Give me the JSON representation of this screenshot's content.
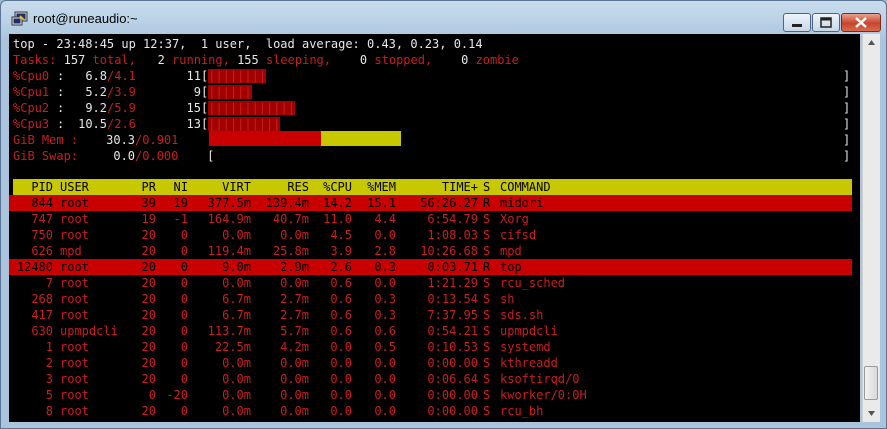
{
  "window": {
    "title": "root@runeaudio:~"
  },
  "summary": {
    "line1": "top - 23:48:45 up 12:37,  1 user,  load average: 0.43, 0.23, 0.14",
    "tasks": {
      "label": "Tasks:",
      "total": "157",
      "total_lbl": "total,",
      "running": "2",
      "running_lbl": "running,",
      "sleeping": "155",
      "sleeping_lbl": "sleeping,",
      "stopped": "0",
      "stopped_lbl": "stopped,",
      "zombie": "0",
      "zombie_lbl": "zombie"
    },
    "cpus": [
      {
        "name": "%Cpu0",
        "sep": ":",
        "value": "6.8",
        "sub": "/4.1",
        "num": "11",
        "bars": "||||||||"
      },
      {
        "name": "%Cpu1",
        "sep": ":",
        "value": "5.2",
        "sub": "/3.9",
        "num": "9",
        "bars": "||||||"
      },
      {
        "name": "%Cpu2",
        "sep": ":",
        "value": "9.2",
        "sub": "/5.9",
        "num": "15",
        "bars": "||||||||||||"
      },
      {
        "name": "%Cpu3",
        "sep": ":",
        "value": "10.5",
        "sub": "/2.6",
        "num": "13",
        "bars": "||||||||||"
      }
    ],
    "mem": {
      "name": "GiB Mem :",
      "value": "30.3",
      "sub": "/0.901",
      "used_fraction": 0.303,
      "cache_fraction": 0.24
    },
    "swap": {
      "name": "GiB Swap:",
      "value": "0.0",
      "sub": "/0.000"
    },
    "open_bracket": "[",
    "close_bracket": "]"
  },
  "columns": [
    "PID",
    "USER",
    "PR",
    "NI",
    "VIRT",
    "RES",
    "%CPU",
    "%MEM",
    "TIME+",
    "S",
    "COMMAND"
  ],
  "processes": [
    {
      "pid": "844",
      "user": "root",
      "pr": "39",
      "ni": "19",
      "virt": "377.5m",
      "res": "139.4m",
      "cpu": "14.2",
      "mem": "15.1",
      "time": "56:26.27",
      "s": "R",
      "cmd": "midori",
      "hl": true
    },
    {
      "pid": "747",
      "user": "root",
      "pr": "19",
      "ni": "-1",
      "virt": "164.9m",
      "res": "40.7m",
      "cpu": "11.0",
      "mem": "4.4",
      "time": "6:54.79",
      "s": "S",
      "cmd": "Xorg",
      "hl": false
    },
    {
      "pid": "750",
      "user": "root",
      "pr": "20",
      "ni": "0",
      "virt": "0.0m",
      "res": "0.0m",
      "cpu": "4.5",
      "mem": "0.0",
      "time": "1:08.03",
      "s": "S",
      "cmd": "cifsd",
      "hl": false
    },
    {
      "pid": "626",
      "user": "mpd",
      "pr": "20",
      "ni": "0",
      "virt": "119.4m",
      "res": "25.8m",
      "cpu": "3.9",
      "mem": "2.8",
      "time": "10:26.68",
      "s": "S",
      "cmd": "mpd",
      "hl": false
    },
    {
      "pid": "12480",
      "user": "root",
      "pr": "20",
      "ni": "0",
      "virt": "9.0m",
      "res": "2.9m",
      "cpu": "2.6",
      "mem": "0.3",
      "time": "0:03.71",
      "s": "R",
      "cmd": "top",
      "hl": true
    },
    {
      "pid": "7",
      "user": "root",
      "pr": "20",
      "ni": "0",
      "virt": "0.0m",
      "res": "0.0m",
      "cpu": "0.6",
      "mem": "0.0",
      "time": "1:21.29",
      "s": "S",
      "cmd": "rcu_sched",
      "hl": false
    },
    {
      "pid": "268",
      "user": "root",
      "pr": "20",
      "ni": "0",
      "virt": "6.7m",
      "res": "2.7m",
      "cpu": "0.6",
      "mem": "0.3",
      "time": "0:13.54",
      "s": "S",
      "cmd": "sh",
      "hl": false
    },
    {
      "pid": "417",
      "user": "root",
      "pr": "20",
      "ni": "0",
      "virt": "6.7m",
      "res": "2.7m",
      "cpu": "0.6",
      "mem": "0.3",
      "time": "7:37.95",
      "s": "S",
      "cmd": "sds.sh",
      "hl": false
    },
    {
      "pid": "630",
      "user": "upmpdcli",
      "pr": "20",
      "ni": "0",
      "virt": "113.7m",
      "res": "5.7m",
      "cpu": "0.6",
      "mem": "0.6",
      "time": "0:54.21",
      "s": "S",
      "cmd": "upmpdcli",
      "hl": false
    },
    {
      "pid": "1",
      "user": "root",
      "pr": "20",
      "ni": "0",
      "virt": "22.5m",
      "res": "4.2m",
      "cpu": "0.0",
      "mem": "0.5",
      "time": "0:10.53",
      "s": "S",
      "cmd": "systemd",
      "hl": false
    },
    {
      "pid": "2",
      "user": "root",
      "pr": "20",
      "ni": "0",
      "virt": "0.0m",
      "res": "0.0m",
      "cpu": "0.0",
      "mem": "0.0",
      "time": "0:00.00",
      "s": "S",
      "cmd": "kthreadd",
      "hl": false
    },
    {
      "pid": "3",
      "user": "root",
      "pr": "20",
      "ni": "0",
      "virt": "0.0m",
      "res": "0.0m",
      "cpu": "0.0",
      "mem": "0.0",
      "time": "0:06.64",
      "s": "S",
      "cmd": "ksoftirqd/0",
      "hl": false
    },
    {
      "pid": "5",
      "user": "root",
      "pr": "0",
      "ni": "-20",
      "virt": "0.0m",
      "res": "0.0m",
      "cpu": "0.0",
      "mem": "0.0",
      "time": "0:00.00",
      "s": "S",
      "cmd": "kworker/0:0H",
      "hl": false
    },
    {
      "pid": "8",
      "user": "root",
      "pr": "20",
      "ni": "0",
      "virt": "0.0m",
      "res": "0.0m",
      "cpu": "0.0",
      "mem": "0.0",
      "time": "0:00.00",
      "s": "S",
      "cmd": "rcu_bh",
      "hl": false
    }
  ],
  "colors": {
    "text": "#e8e8e8",
    "red": "#c81e1e",
    "highlight": "#c80000",
    "header": "#c8c800",
    "mem_cache": "#c8c800"
  },
  "icons": {
    "app": "putty-terminal-icon",
    "minimize": "minimize-icon",
    "maximize": "maximize-icon",
    "close": "close-icon"
  }
}
